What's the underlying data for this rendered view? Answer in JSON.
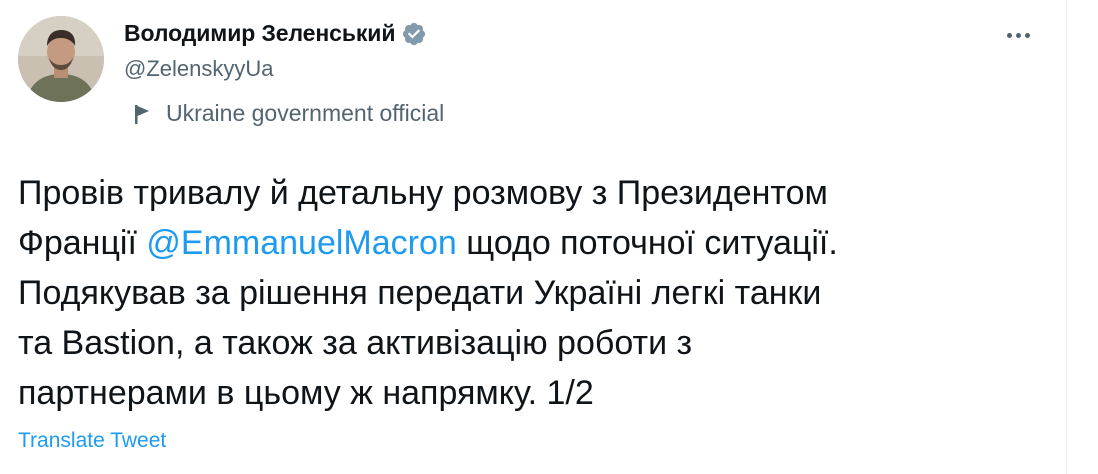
{
  "author": {
    "name": "Володимир Зеленський",
    "handle": "@ZelenskyyUa",
    "verified_icon": "verified-badge-icon",
    "label": "Ukraine government official",
    "label_icon": "flag-icon"
  },
  "more_icon": "more-options-icon",
  "tweet": {
    "line1": "Провів тривалу й детальну розмову з Президентом",
    "line2_before": "Франції ",
    "mention": "@EmmanuelMacron",
    "line2_after": " щодо поточної ситуації.",
    "line3": "Подякував за рішення передати Україні легкі танки",
    "line4": "та Bastion, а також за активізацію роботи з",
    "line5": "партнерами в цьому ж напрямку. 1/2"
  },
  "translate_link": "Translate Tweet",
  "colors": {
    "accent": "#1d9bf0",
    "text": "#0f1419",
    "secondary": "#536471",
    "verified_badge": "#829aab"
  }
}
